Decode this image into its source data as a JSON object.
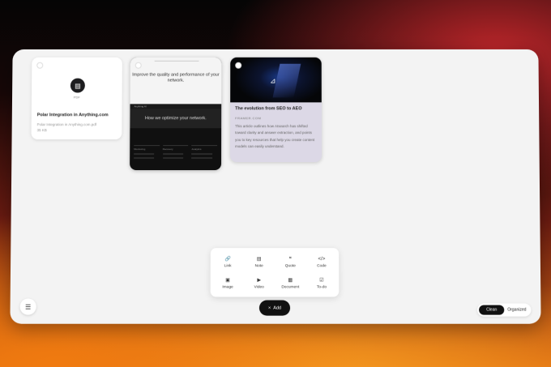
{
  "cards": {
    "pdf": {
      "type_label": "PDF",
      "title": "Polar Integration in Anything.com",
      "subtitle": "Polar Integration in Anything.com.pdf",
      "size": "35 KB"
    },
    "site": {
      "headline": "Improve the quality and performance of your network.",
      "bar_label": "Anything AI",
      "section_heading": "How we optimize your network.",
      "columns": [
        "Monitoring",
        "Recovery",
        "Analytics"
      ]
    },
    "article": {
      "title": "The evolution from SEO to AEO",
      "source": "FRAMER.COM",
      "body": "This article outlines how AIsearch has shifted toward clarity and answer extraction, and points you to key resources that help you create content models can easily understand."
    }
  },
  "add_menu": {
    "items": [
      {
        "label": "Link",
        "icon": "link-icon",
        "glyph": "🔗"
      },
      {
        "label": "Note",
        "icon": "note-icon",
        "glyph": "▤"
      },
      {
        "label": "Quote",
        "icon": "quote-icon",
        "glyph": "❝"
      },
      {
        "label": "Code",
        "icon": "code-icon",
        "glyph": "</>"
      },
      {
        "label": "Image",
        "icon": "image-icon",
        "glyph": "▣"
      },
      {
        "label": "Video",
        "icon": "video-icon",
        "glyph": "▶"
      },
      {
        "label": "Document",
        "icon": "document-icon",
        "glyph": "▦"
      },
      {
        "label": "To-do",
        "icon": "todo-icon",
        "glyph": "☑"
      }
    ]
  },
  "add_button": {
    "label": "Add",
    "glyph": "×"
  },
  "menu_glyph": "☰",
  "view_toggle": {
    "clean": "Clean",
    "organized": "Organized",
    "active": "Clean"
  },
  "colors": {
    "accent": "#111111",
    "board": "#f3f3f3",
    "article_bg": "#dcd8e6"
  }
}
